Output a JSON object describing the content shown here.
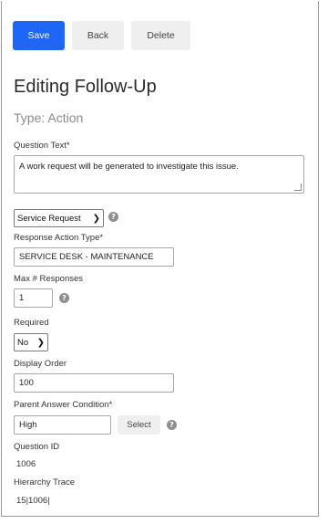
{
  "toolbar": {
    "save_label": "Save",
    "back_label": "Back",
    "delete_label": "Delete"
  },
  "heading": {
    "title": "Editing Follow-Up",
    "type": "Type: Action"
  },
  "form": {
    "question_text_label": "Question Text*",
    "question_text_value": "A work request will be generated to investigate this issue.",
    "request_type_selected": "Service Request",
    "response_action_type_label": "Response Action Type*",
    "response_action_type_value": "SERVICE DESK - MAINTENANCE",
    "max_responses_label": "Max # Responses",
    "max_responses_value": "1",
    "required_label": "Required",
    "required_selected": "No",
    "display_order_label": "Display Order",
    "display_order_value": "100",
    "parent_condition_label": "Parent Answer Condition*",
    "parent_condition_value": "High",
    "select_label": "Select",
    "question_id_label": "Question ID",
    "question_id_value": "1006",
    "hierarchy_trace_label": "Hierarchy Trace",
    "hierarchy_trace_value": "15|1006|"
  },
  "icons": {
    "help": "?",
    "chevron": "❯"
  },
  "colors": {
    "primary": "#1e66f5",
    "secondary": "#efefef"
  }
}
